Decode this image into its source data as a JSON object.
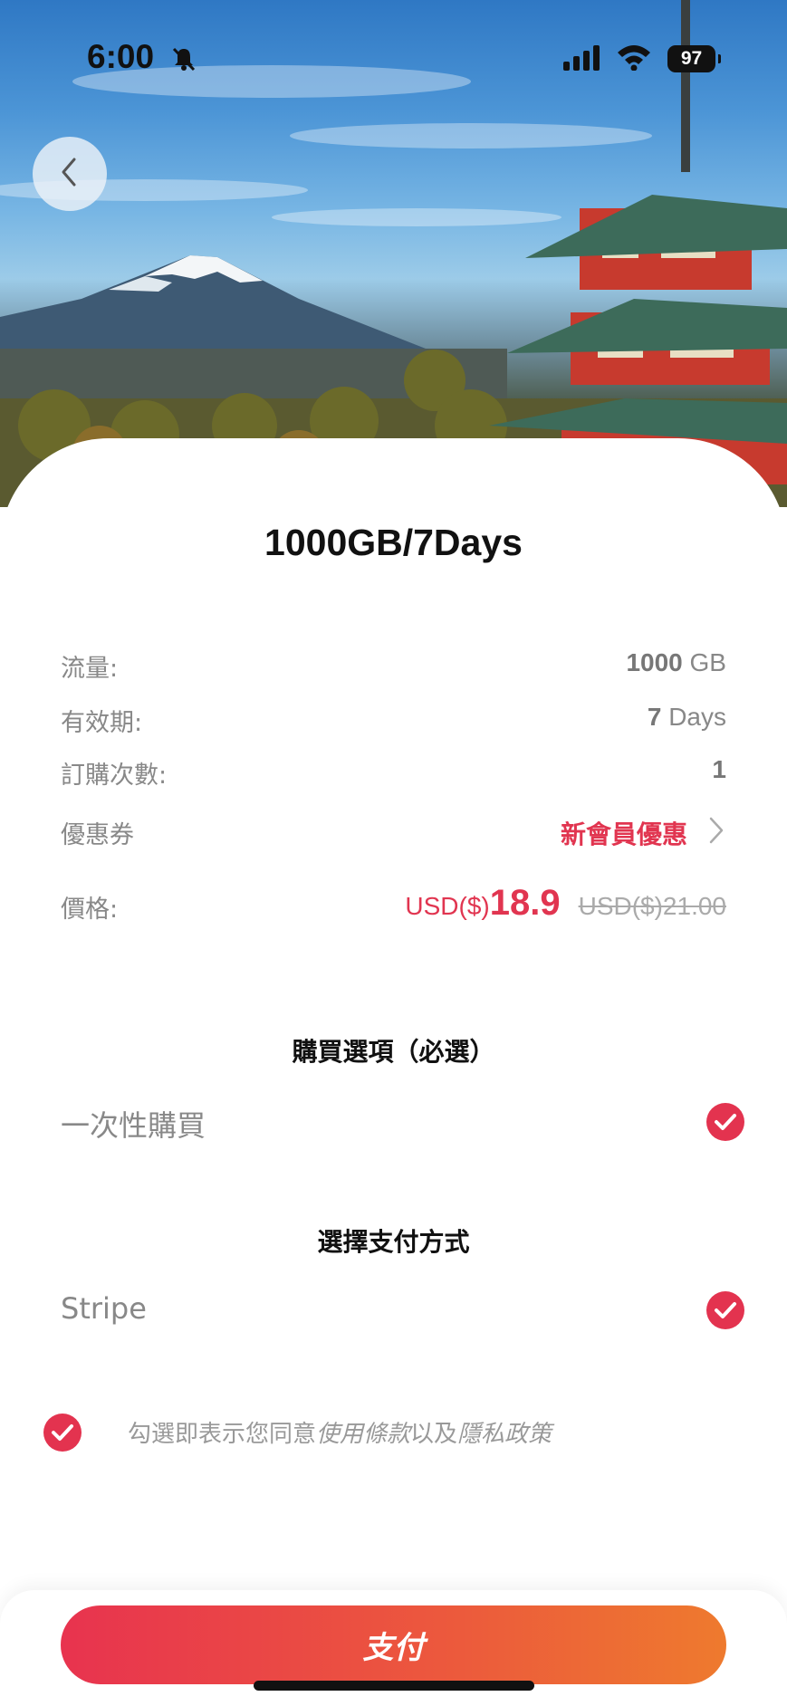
{
  "status_bar": {
    "time": "6:00",
    "battery": "97"
  },
  "product": {
    "title": "1000GB/7Days"
  },
  "details": {
    "data": {
      "label": "流量:",
      "value": "1000",
      "unit": "GB"
    },
    "validity": {
      "label": "有效期:",
      "value": "7",
      "unit": "Days"
    },
    "quantity": {
      "label": "訂購次數:",
      "value": "1"
    },
    "coupon": {
      "label": "優惠券",
      "value": "新會員優惠"
    },
    "price": {
      "label": "價格:",
      "currency": "USD($)",
      "amount": "18.9",
      "original": "USD($)21.00"
    }
  },
  "purchase_option": {
    "title": "購買選項（必選）",
    "option": "一次性購買",
    "selected": true
  },
  "payment_method": {
    "title": "選擇支付方式",
    "option": "Stripe",
    "selected": true
  },
  "terms": {
    "prefix": "勾選即表示您同意",
    "terms_link": "使用條款",
    "conjunction": "以及",
    "privacy_link": "隱私政策",
    "checked": true
  },
  "pay_button": {
    "label": "支付"
  },
  "colors": {
    "accent": "#e3334f",
    "gradient_end": "#ee7a2e"
  },
  "icons": {
    "back": "chevron-left-icon",
    "coupon_chevron": "chevron-right-icon",
    "check": "check-circle-icon",
    "bell": "bell-slash-icon"
  }
}
